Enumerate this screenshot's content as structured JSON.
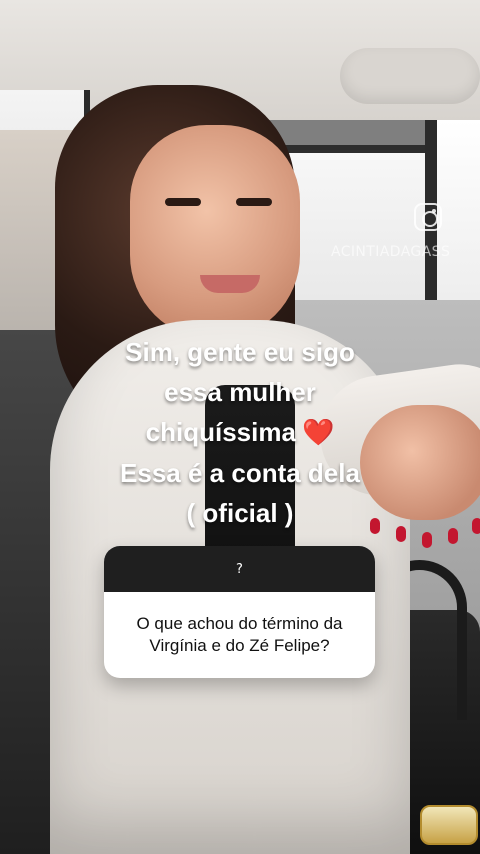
{
  "story": {
    "caption_lines": [
      "Sim, gente eu sigo",
      "essa mulher",
      "chiquíssima",
      "Essa é a conta dela",
      "( oficial )"
    ],
    "caption_emoji": "❤️",
    "watermark": {
      "handle_text": "ACINTIADAGASS",
      "icon": "instagram-icon"
    },
    "question_box": {
      "header_text": "?",
      "question_text": "O que achou do término da Virgínia e do Zé Felipe?"
    }
  },
  "colors": {
    "caption_text": "#ffffff",
    "emoji_heart": "#e01919",
    "question_header_bg": "#1f1f1f",
    "question_body_bg": "#ffffff"
  }
}
